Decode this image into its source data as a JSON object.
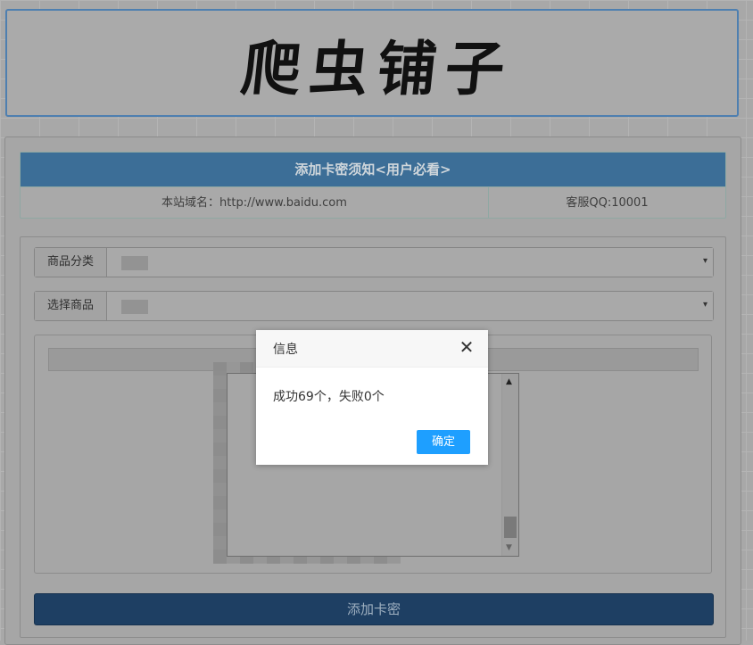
{
  "header": {
    "logo_text": "爬虫铺子"
  },
  "notice": {
    "title": "添加卡密须知<用户必看>",
    "domain_text": "本站域名：http://www.baidu.com",
    "qq_text": "客服QQ:10001"
  },
  "form": {
    "category_label": "商品分类",
    "product_label": "选择商品",
    "caret": "▾",
    "submit_label": "添加卡密"
  },
  "dialog": {
    "title": "信息",
    "close_glyph": "✕",
    "message": "成功69个，失败0个",
    "ok_label": "确定"
  },
  "icons": {
    "close": "close-icon",
    "dropdown": "chevron-down-icon",
    "scroll_up": "arrow-up-icon",
    "scroll_down": "arrow-down-icon"
  },
  "colors": {
    "notice_bar": "#3c6e97",
    "submit_bg": "#1e3f63",
    "ok_button": "#1e9fff"
  }
}
